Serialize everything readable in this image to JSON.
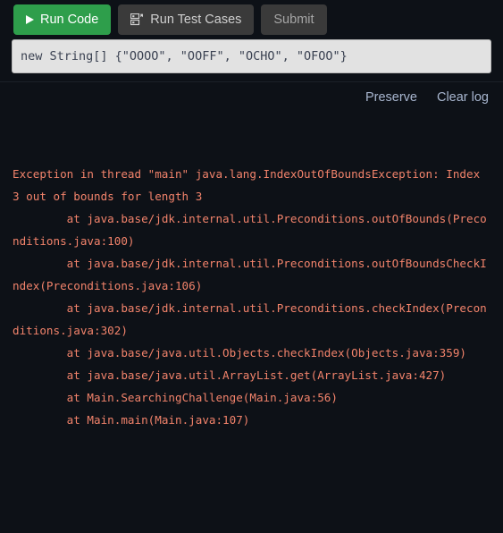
{
  "theme": {
    "background": "#0d1117",
    "accent_green": "#2e9e4b",
    "button_grey": "#3a3a3a",
    "link_blue": "#a8b6cf",
    "error_text": "#f2836b",
    "input_background": "#e2e2e2",
    "input_text": "#3b4252"
  },
  "toolbar": {
    "run_code_label": "Run Code",
    "run_code_icon": "play-icon",
    "run_test_cases_label": "Run Test Cases",
    "run_test_cases_icon": "test-cases-icon",
    "submit_label": "Submit"
  },
  "input": {
    "value": "new String[] {\"OOOO\", \"OOFF\", \"OCHO\", \"OFOO\"}",
    "placeholder": "new String[] {\"OOOO\", \"OOFF\", \"OCHO\", \"OFOO\"}"
  },
  "console_header": {
    "preserve_label": "Preserve",
    "clear_log_label": "Clear log"
  },
  "console": {
    "lines": [
      "Exception in thread \"main\" java.lang.IndexOutOfBoundsException: Index 3 out of bounds for length 3",
      "\tat java.base/jdk.internal.util.Preconditions.outOfBounds(Preconditions.java:100)",
      "\tat java.base/jdk.internal.util.Preconditions.outOfBoundsCheckIndex(Preconditions.java:106)",
      "\tat java.base/jdk.internal.util.Preconditions.checkIndex(Preconditions.java:302)",
      "\tat java.base/java.util.Objects.checkIndex(Objects.java:359)",
      "\tat java.base/java.util.ArrayList.get(ArrayList.java:427)",
      "\tat Main.SearchingChallenge(Main.java:56)",
      "\tat Main.main(Main.java:107)"
    ]
  }
}
